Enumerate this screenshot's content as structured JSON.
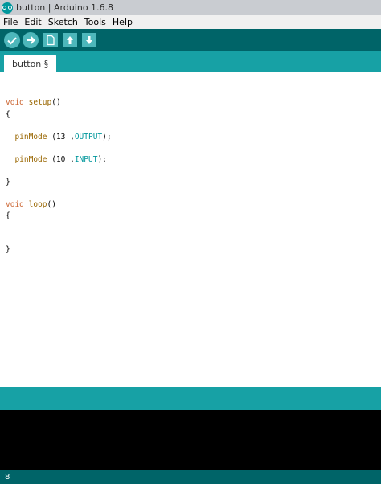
{
  "window": {
    "title": "button | Arduino 1.6.8"
  },
  "menu": [
    "File",
    "Edit",
    "Sketch",
    "Tools",
    "Help"
  ],
  "toolbar": {
    "verify": {
      "icon": "checkmark-icon"
    },
    "upload": {
      "icon": "arrow-right-icon"
    },
    "new": {
      "icon": "new-file-icon"
    },
    "open": {
      "icon": "arrow-up-icon"
    },
    "save": {
      "icon": "arrow-down-icon"
    }
  },
  "tab": {
    "label": "button §"
  },
  "code": {
    "l1_kw": "void",
    "l1_fn": "setup",
    "l1_rest": "()",
    "l2": "{",
    "l3_fn": "pinMode",
    "l3_mid": " (13 ,",
    "l3_const": "OUTPUT",
    "l3_end": ");",
    "l4_fn": "pinMode",
    "l4_mid": " (10 ,",
    "l4_const": "INPUT",
    "l4_end": ");",
    "l5": "}",
    "l6_kw": "void",
    "l6_fn": "loop",
    "l6_rest": "()",
    "l7": "{",
    "l8": "}"
  },
  "footer": {
    "line_number": "8"
  },
  "colors": {
    "toolbar_bg": "#006468",
    "tab_bar_bg": "#17a1a5",
    "button_fill": "#4db7bb",
    "keyword": "#cc6633",
    "function": "#996600",
    "constant": "#00979c",
    "console_bg": "#000000"
  }
}
